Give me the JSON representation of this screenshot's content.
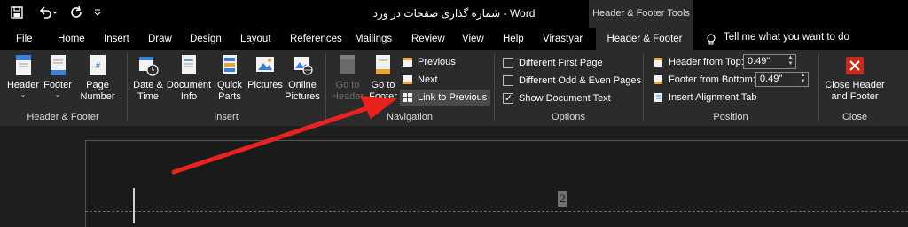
{
  "title_bar": {
    "document_title": "شماره گذاری صفحات در ورد",
    "separator": "-",
    "app_name": "Word",
    "contextual_tools": "Header & Footer Tools",
    "icons": [
      "save-icon",
      "undo-icon",
      "redo-icon",
      "customize-icon"
    ]
  },
  "tabs": {
    "file": "File",
    "home": "Home",
    "insert": "Insert",
    "draw": "Draw",
    "design": "Design",
    "layout": "Layout",
    "references": "References",
    "mailings": "Mailings",
    "review": "Review",
    "view": "View",
    "help": "Help",
    "virastyar": "Virastyar",
    "header_footer": "Header & Footer",
    "tell_me": "Tell me what you want to do"
  },
  "ribbon": {
    "header_footer_group": {
      "label": "Header & Footer",
      "header": "Header",
      "footer": "Footer",
      "page_number": "Page\nNumber"
    },
    "insert_group": {
      "label": "Insert",
      "date_time": "Date &\nTime",
      "document_info": "Document\nInfo",
      "quick_parts": "Quick\nParts",
      "pictures": "Pictures",
      "online_pictures": "Online\nPictures"
    },
    "navigation_group": {
      "label": "Navigation",
      "go_to_header": "Go to\nHeader",
      "go_to_footer": "Go to\nFooter",
      "previous": "Previous",
      "next": "Next",
      "link_to_previous": "Link to Previous"
    },
    "options_group": {
      "label": "Options",
      "different_first_page": "Different First Page",
      "different_odd_even": "Different Odd & Even Pages",
      "show_document_text": "Show Document Text",
      "different_first_page_checked": false,
      "different_odd_even_checked": false,
      "show_document_text_checked": true
    },
    "position_group": {
      "label": "Position",
      "header_from_top": "Header from Top:",
      "header_from_top_value": "0.49\"",
      "footer_from_bottom": "Footer from Bottom:",
      "footer_from_bottom_value": "0.49\"",
      "insert_alignment_tab": "Insert Alignment Tab"
    },
    "close_group": {
      "label": "Close",
      "close_header_footer": "Close Header\nand Footer"
    }
  },
  "document": {
    "page_number_field": "2"
  },
  "colors": {
    "titlebar_bg": "#000000",
    "ribbon_bg": "#2b2b2b",
    "canvas_bg": "#1f1f1f",
    "annotation_arrow": "#e8231f",
    "close_button_red": "#c42b1c"
  }
}
